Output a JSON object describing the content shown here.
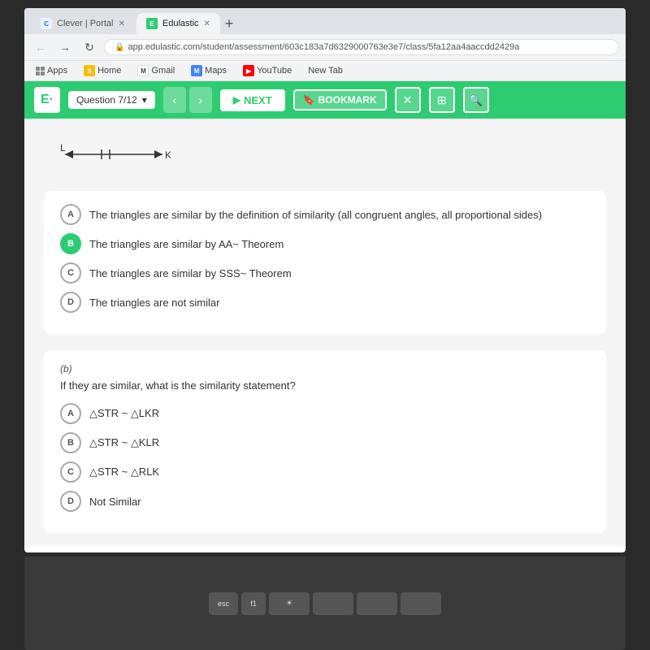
{
  "browser": {
    "tabs": [
      {
        "label": "Clever | Portal",
        "favicon": "C",
        "active": false,
        "color": "#1a73e8"
      },
      {
        "label": "Edulastic",
        "favicon": "E",
        "active": true,
        "color": "#2ecc71"
      }
    ],
    "address": "app.edulastic.com/student/assessment/603c183a7d6329000763e3e7/class/5fa12aa4aaccdd2429a",
    "bookmarks": [
      {
        "label": "Apps"
      },
      {
        "label": "Home",
        "favicon": "S",
        "color": "#fbbc04"
      },
      {
        "label": "Gmail",
        "favicon": "M",
        "color": "#ea4335"
      },
      {
        "label": "Maps",
        "favicon": "Ma",
        "color": "#4285f4"
      },
      {
        "label": "YouTube",
        "favicon": "▶",
        "color": "#ff0000"
      },
      {
        "label": "New Tab"
      }
    ]
  },
  "header": {
    "logo": "E·",
    "question_selector": "Question 7/12",
    "next_label": "NEXT",
    "bookmark_label": "BOOKMARK"
  },
  "part_a": {
    "options": [
      {
        "id": "A",
        "text": "The triangles are similar by the definition of similarity (all congruent angles, all proportional sides)",
        "selected": false
      },
      {
        "id": "B",
        "text": "The triangles are similar by AA~ Theorem",
        "selected": true
      },
      {
        "id": "C",
        "text": "The triangles are similar by SSS~ Theorem",
        "selected": false
      },
      {
        "id": "D",
        "text": "The triangles are not similar",
        "selected": false
      }
    ]
  },
  "part_b": {
    "label": "(b)",
    "question": "If they are similar, what is the similarity statement?",
    "options": [
      {
        "id": "A",
        "text": "△STR ~ △LKR",
        "selected": false
      },
      {
        "id": "B",
        "text": "△STR ~ △KLR",
        "selected": false
      },
      {
        "id": "C",
        "text": "△STR ~ △RLK",
        "selected": false
      },
      {
        "id": "D",
        "text": "Not Similar",
        "selected": false
      }
    ]
  },
  "diagram": {
    "label_left": "L",
    "label_right": "K",
    "arrows": "←→"
  }
}
